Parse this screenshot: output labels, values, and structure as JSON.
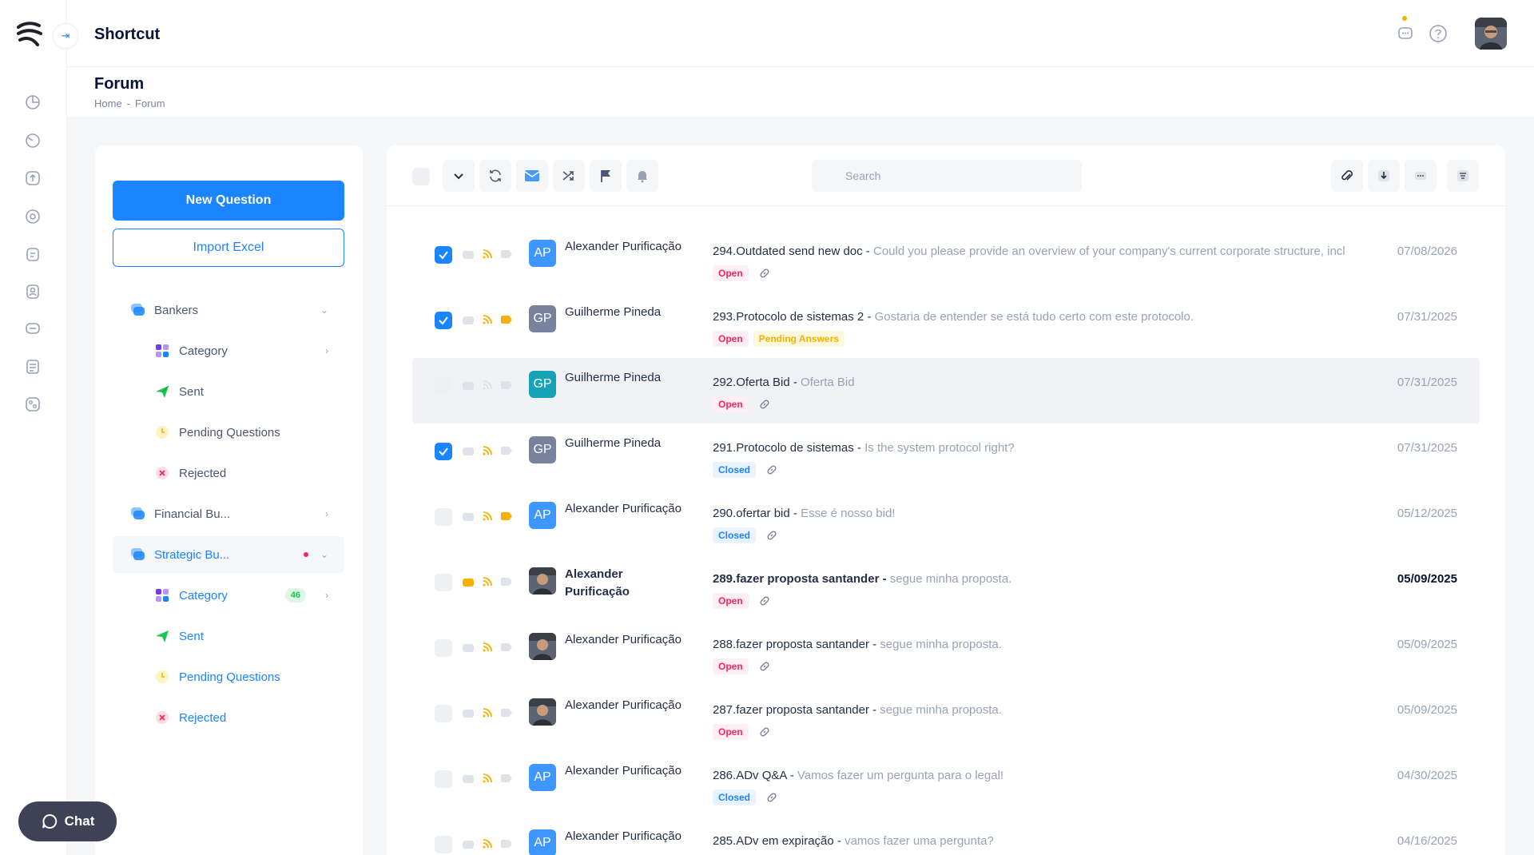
{
  "app": {
    "title": "Shortcut"
  },
  "page": {
    "title": "Forum",
    "breadcrumb": [
      "Home",
      "-",
      "Forum"
    ]
  },
  "colors": {
    "primary": "#1b84ff",
    "open": "#f8285a",
    "closed": "#1b84ff",
    "pending": "#f6b100",
    "rss": "#f6b100"
  },
  "rail_icons": [
    "dashboard-icon",
    "chart-icon",
    "upload-icon",
    "settings-icon",
    "clipboard-icon",
    "contacts-icon",
    "forum-icon",
    "document-icon",
    "apps-icon"
  ],
  "left": {
    "new_question": "New Question",
    "import_excel": "Import Excel",
    "groups": [
      {
        "label": "Bankers",
        "children": [
          {
            "label": "Category",
            "icon": "category-icon"
          },
          {
            "label": "Sent",
            "icon": "sent-icon"
          },
          {
            "label": "Pending Questions",
            "icon": "clock-icon"
          },
          {
            "label": "Rejected",
            "icon": "rejected-icon"
          }
        ]
      },
      {
        "label": "Financial Bu..."
      },
      {
        "label": "Strategic Bu...",
        "children": [
          {
            "label": "Category",
            "badge": "46"
          },
          {
            "label": "Sent"
          },
          {
            "label": "Pending Questions"
          },
          {
            "label": "Rejected"
          }
        ]
      }
    ]
  },
  "toolbar": {
    "search_placeholder": "Search"
  },
  "rows": [
    {
      "checked": true,
      "initials": "AP",
      "name": "Alexander Purificação",
      "subject": "294.Outdated send new doc -",
      "preview": " Could you please provide an overview of your company's current corporate structure, incl",
      "tags": [
        "Open"
      ],
      "date": "07/08/2026"
    },
    {
      "checked": true,
      "initials": "GP",
      "name": "Guilherme Pineda",
      "subject": "293.Protocolo de sistemas 2 -",
      "preview": " Gostaria de entender se está tudo certo com este protocolo.",
      "tags": [
        "Open",
        "Pending Answers"
      ],
      "date": "07/31/2025"
    },
    {
      "checked": false,
      "initials": "GP",
      "name": "Guilherme Pineda",
      "subject": "292.Oferta Bid -",
      "preview": " Oferta Bid",
      "tags": [
        "Open"
      ],
      "date": "07/31/2025"
    },
    {
      "checked": true,
      "initials": "GP",
      "name": "Guilherme Pineda",
      "subject": "291.Protocolo de sistemas -",
      "preview": " Is the system protocol right?",
      "tags": [
        "Closed"
      ],
      "date": "07/31/2025"
    },
    {
      "checked": false,
      "initials": "AP",
      "name": "Alexander Purificação",
      "subject": "290.ofertar bid -",
      "preview": " Esse é nosso bid!",
      "tags": [
        "Closed"
      ],
      "date": "05/12/2025"
    },
    {
      "checked": false,
      "initials": "",
      "name": "Alexander Purificação",
      "subject": "289.fazer proposta santander -",
      "preview": " segue minha proposta.",
      "tags": [
        "Open"
      ],
      "date": "05/09/2025"
    },
    {
      "checked": false,
      "initials": "",
      "name": "Alexander Purificação",
      "subject": "288.fazer proposta santander -",
      "preview": " segue minha proposta.",
      "tags": [
        "Open"
      ],
      "date": "05/09/2025"
    },
    {
      "checked": false,
      "initials": "",
      "name": "Alexander Purificação",
      "subject": "287.fazer proposta santander -",
      "preview": " segue minha proposta.",
      "tags": [
        "Open"
      ],
      "date": "05/09/2025"
    },
    {
      "checked": false,
      "initials": "AP",
      "name": "Alexander Purificação",
      "subject": "286.ADv Q&A -",
      "preview": " Vamos fazer um pergunta para o legal!",
      "tags": [
        "Closed"
      ],
      "date": "04/30/2025"
    },
    {
      "checked": false,
      "initials": "AP",
      "name": "Alexander Purificação",
      "subject": "285.ADv em expiração -",
      "preview": " vamos fazer uma pergunta?",
      "tags": [],
      "date": "04/16/2025"
    }
  ],
  "chat": {
    "label": "Chat"
  }
}
